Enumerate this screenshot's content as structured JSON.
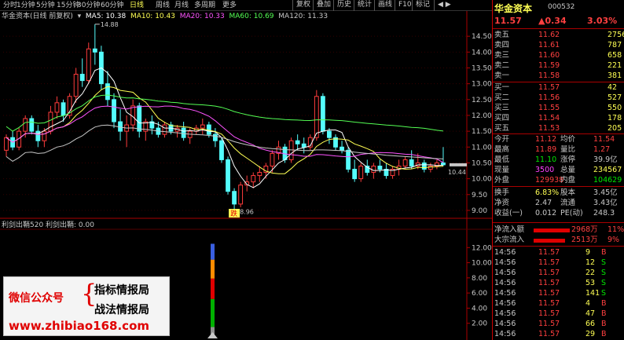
{
  "toolbar": {
    "periods": [
      "分时",
      "1分钟",
      "5分钟",
      "15分钟",
      "30分钟",
      "60分钟",
      "日线",
      "周线",
      "月线",
      "多周期",
      "更多"
    ],
    "active_period": "日线",
    "buttons": [
      "复权",
      "叠加",
      "历史",
      "统计",
      "画线",
      "F10",
      "标记"
    ]
  },
  "legend": {
    "stock": "华金资本(日线 前复权)",
    "ma5": "MA5: 10.38",
    "ma10": "MA10: 10.43",
    "ma20": "MA20: 10.33",
    "ma60": "MA60: 10.69",
    "ma120": "MA120: 11.33",
    "indicator": "利剑出鞘520  利剑出鞘: 0.00"
  },
  "colors": {
    "up": "#ff3c3c",
    "down": "#54fcfc",
    "ma5": "#ffffff",
    "ma10": "#ffff54",
    "ma20": "#ff54ff",
    "ma60": "#54ff54",
    "ma120": "#c8c8c8"
  },
  "chart_data": {
    "type": "candlestick",
    "ylim": [
      8.8,
      15.0
    ],
    "yticks": [
      "14.50",
      "14.00",
      "13.50",
      "13.00",
      "12.50",
      "12.00",
      "11.50",
      "11.00",
      "10.50",
      "10.00",
      "9.50",
      "9.00"
    ],
    "annotations": {
      "high": "14.88",
      "low": "8.96",
      "last": "10.44"
    },
    "candles": [
      [
        10.9,
        11.4,
        10.7,
        11.3
      ],
      [
        11.3,
        11.5,
        10.9,
        11.0
      ],
      [
        11.0,
        11.6,
        10.9,
        11.5
      ],
      [
        11.5,
        12.0,
        11.3,
        11.9
      ],
      [
        11.9,
        12.0,
        11.4,
        11.5
      ],
      [
        11.5,
        11.7,
        11.0,
        11.2
      ],
      [
        11.2,
        11.6,
        11.0,
        11.5
      ],
      [
        11.5,
        12.3,
        11.4,
        12.1
      ],
      [
        12.1,
        12.6,
        11.9,
        12.4
      ],
      [
        12.4,
        12.5,
        11.8,
        12.0
      ],
      [
        12.0,
        12.7,
        11.9,
        12.6
      ],
      [
        12.6,
        13.5,
        12.4,
        13.3
      ],
      [
        13.3,
        13.8,
        12.9,
        13.1
      ],
      [
        13.1,
        14.3,
        13.0,
        14.1
      ],
      [
        14.1,
        14.88,
        13.6,
        14.0
      ],
      [
        14.0,
        14.2,
        12.8,
        13.0
      ],
      [
        13.0,
        13.4,
        12.3,
        12.5
      ],
      [
        12.5,
        12.7,
        11.6,
        11.8
      ],
      [
        11.8,
        12.2,
        11.2,
        11.5
      ],
      [
        11.5,
        12.0,
        11.0,
        11.7
      ],
      [
        11.7,
        12.5,
        11.5,
        12.3
      ],
      [
        12.3,
        12.4,
        11.3,
        11.5
      ],
      [
        11.5,
        11.9,
        11.2,
        11.8
      ],
      [
        11.8,
        12.0,
        11.4,
        11.6
      ],
      [
        11.6,
        11.8,
        11.3,
        11.4
      ],
      [
        11.4,
        11.8,
        11.3,
        11.7
      ],
      [
        11.7,
        11.8,
        11.4,
        11.5
      ],
      [
        11.5,
        11.7,
        11.3,
        11.6
      ],
      [
        11.6,
        11.8,
        11.2,
        11.3
      ],
      [
        11.3,
        11.6,
        11.1,
        11.5
      ],
      [
        11.5,
        11.7,
        11.4,
        11.6
      ],
      [
        11.6,
        11.9,
        11.4,
        11.7
      ],
      [
        11.7,
        11.8,
        11.3,
        11.4
      ],
      [
        11.4,
        11.6,
        11.0,
        11.2
      ],
      [
        11.2,
        11.3,
        10.5,
        10.6
      ],
      [
        10.6,
        10.7,
        9.5,
        9.6
      ],
      [
        9.6,
        9.7,
        8.96,
        9.2
      ],
      [
        9.2,
        9.9,
        9.1,
        9.8
      ],
      [
        9.8,
        10.1,
        9.6,
        9.9
      ],
      [
        9.9,
        10.2,
        9.7,
        10.1
      ],
      [
        10.1,
        10.4,
        9.9,
        10.2
      ],
      [
        10.2,
        10.5,
        10.0,
        10.4
      ],
      [
        10.4,
        10.9,
        10.2,
        10.8
      ],
      [
        10.8,
        11.2,
        10.6,
        11.0
      ],
      [
        11.0,
        11.1,
        10.5,
        10.6
      ],
      [
        10.6,
        11.3,
        10.5,
        11.2
      ],
      [
        11.2,
        11.4,
        10.9,
        11.1
      ],
      [
        11.1,
        11.3,
        10.8,
        11.0
      ],
      [
        11.0,
        11.4,
        10.9,
        11.3
      ],
      [
        11.3,
        12.8,
        11.2,
        12.6
      ],
      [
        12.6,
        12.7,
        11.4,
        11.5
      ],
      [
        11.5,
        11.6,
        11.1,
        11.3
      ],
      [
        11.3,
        11.4,
        10.9,
        11.0
      ],
      [
        11.0,
        11.2,
        10.8,
        10.9
      ],
      [
        10.9,
        11.0,
        10.2,
        10.3
      ],
      [
        10.3,
        10.6,
        9.9,
        10.0
      ],
      [
        10.0,
        10.5,
        9.9,
        10.4
      ],
      [
        10.4,
        10.6,
        10.1,
        10.2
      ],
      [
        10.2,
        10.5,
        10.0,
        10.4
      ],
      [
        10.4,
        10.6,
        10.2,
        10.3
      ],
      [
        10.3,
        10.5,
        10.0,
        10.1
      ],
      [
        10.1,
        10.4,
        10.0,
        10.3
      ],
      [
        10.3,
        10.6,
        10.1,
        10.4
      ],
      [
        10.4,
        10.7,
        10.3,
        10.6
      ],
      [
        10.6,
        10.9,
        10.3,
        10.4
      ],
      [
        10.4,
        10.8,
        10.3,
        10.5
      ],
      [
        10.5,
        10.6,
        10.2,
        10.3
      ],
      [
        10.3,
        10.5,
        10.2,
        10.4
      ],
      [
        10.4,
        10.6,
        10.3,
        10.5
      ],
      [
        10.5,
        11.0,
        10.4,
        10.44
      ]
    ],
    "indicator_ylim": [
      0,
      14
    ],
    "indicator_yticks": [
      "12.00",
      "10.00",
      "8.00",
      "6.00",
      "4.00",
      "2.00"
    ]
  },
  "right_panel": {
    "name": "华金资本",
    "code": "000532",
    "price": "11.57",
    "change": "▲0.34",
    "pct": "3.03%",
    "asks": [
      {
        "label": "卖五",
        "price": "11.62",
        "vol": "2756"
      },
      {
        "label": "卖四",
        "price": "11.61",
        "vol": "787"
      },
      {
        "label": "卖三",
        "price": "11.60",
        "vol": "658"
      },
      {
        "label": "卖二",
        "price": "11.59",
        "vol": "221"
      },
      {
        "label": "卖一",
        "price": "11.58",
        "vol": "381"
      }
    ],
    "bids": [
      {
        "label": "买一",
        "price": "11.57",
        "vol": "42"
      },
      {
        "label": "买二",
        "price": "11.56",
        "vol": "527"
      },
      {
        "label": "买三",
        "price": "11.55",
        "vol": "550"
      },
      {
        "label": "买四",
        "price": "11.54",
        "vol": "178"
      },
      {
        "label": "买五",
        "price": "11.53",
        "vol": "205"
      }
    ],
    "stats": [
      {
        "l1": "今开",
        "v1": "11.12",
        "l2": "均价",
        "v2": "11.54"
      },
      {
        "l1": "最高",
        "v1": "11.89",
        "l2": "量比",
        "v2": "1.27"
      },
      {
        "l1": "最低",
        "v1": "11.10",
        "l2": "涨停",
        "v2": "39.9亿"
      },
      {
        "l1": "现量",
        "v1": "3500",
        "l2": "总量",
        "v2": "234567"
      },
      {
        "l1": "外盘",
        "v1": "129938",
        "l2": "内盘",
        "v2": "104629"
      }
    ],
    "stats2": [
      {
        "l1": "换手",
        "v1": "6.83%",
        "l2": "股本",
        "v2": "3.45亿"
      },
      {
        "l1": "净资",
        "v1": "2.47",
        "l2": "流通",
        "v2": "3.43亿"
      },
      {
        "l1": "收益(一)",
        "v1": "0.012",
        "l2": "PE(动)",
        "v2": "248.3"
      }
    ],
    "flows": [
      {
        "label": "净流入额",
        "value": "2968万",
        "extra": "11%"
      },
      {
        "label": "大宗流入",
        "value": "2513万",
        "extra": "9%"
      }
    ],
    "ticks": [
      {
        "t": "14:56",
        "p": "11.57",
        "v": "9",
        "s": "B"
      },
      {
        "t": "14:56",
        "p": "11.57",
        "v": "12",
        "s": "S"
      },
      {
        "t": "14:56",
        "p": "11.57",
        "v": "22",
        "s": "S"
      },
      {
        "t": "14:56",
        "p": "11.57",
        "v": "53",
        "s": "S"
      },
      {
        "t": "14:56",
        "p": "11.57",
        "v": "141",
        "s": "S"
      },
      {
        "t": "14:56",
        "p": "11.57",
        "v": "4",
        "s": "B"
      },
      {
        "t": "14:56",
        "p": "11.57",
        "v": "47",
        "s": "B"
      },
      {
        "t": "14:56",
        "p": "11.57",
        "v": "66",
        "s": "B"
      },
      {
        "t": "14:56",
        "p": "11.57",
        "v": "29",
        "s": "B"
      }
    ]
  },
  "watermark": {
    "wechat": "微信公众号",
    "line1": "指标情报局",
    "line2": "战法情报局",
    "url": "www.zhibiao168.com"
  },
  "signal_label": "跌"
}
